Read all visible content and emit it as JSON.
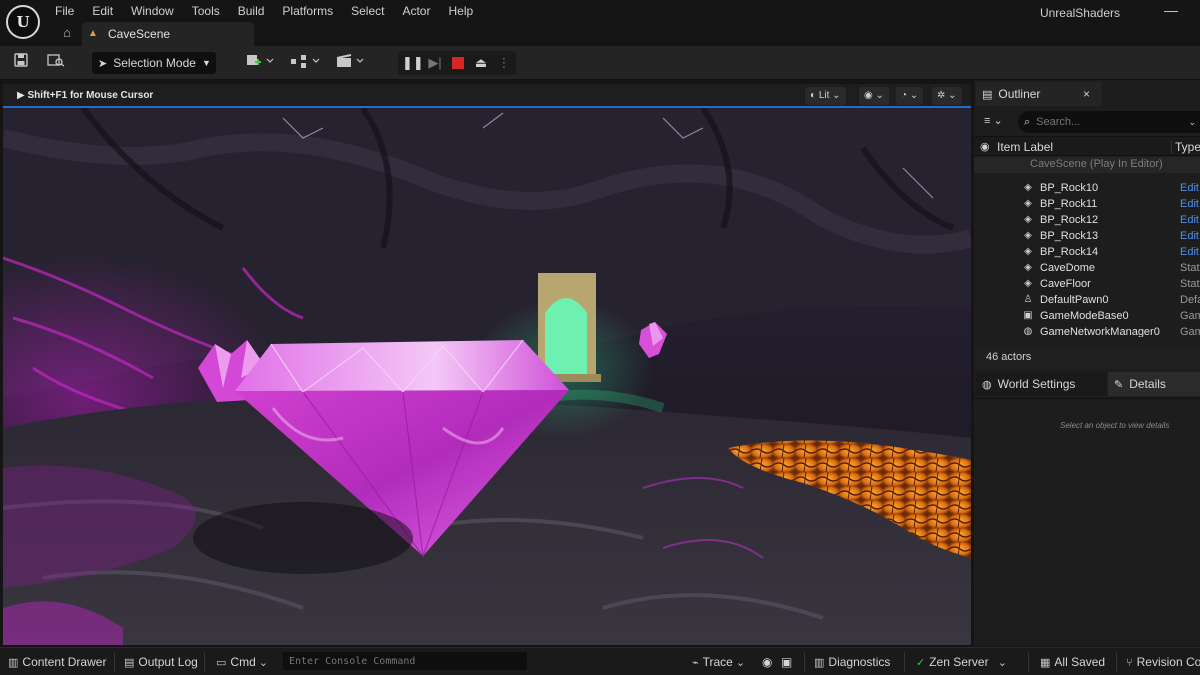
{
  "app": {
    "logo_text": "U",
    "project": "UnrealShaders",
    "minimize_glyph": "—"
  },
  "menu": [
    "File",
    "Edit",
    "Window",
    "Tools",
    "Build",
    "Platforms",
    "Select",
    "Actor",
    "Help"
  ],
  "doc_tab": {
    "label": "CaveScene"
  },
  "toolbar": {
    "selection_mode": "Selection Mode"
  },
  "viewport": {
    "hint": "Shift+F1 for Mouse Cursor",
    "view_mode": "Lit"
  },
  "outliner": {
    "tab": "Outliner",
    "search_placeholder": "Search...",
    "col_label": "Item Label",
    "col_type": "Type",
    "root": "CaveScene (Play In Editor)",
    "items": [
      {
        "name": "BP_Rock10",
        "type": "Edit",
        "icon": "blueprint-icon",
        "link": true
      },
      {
        "name": "BP_Rock11",
        "type": "Edit",
        "icon": "blueprint-icon",
        "link": true
      },
      {
        "name": "BP_Rock12",
        "type": "Edit",
        "icon": "blueprint-icon",
        "link": true
      },
      {
        "name": "BP_Rock13",
        "type": "Edit",
        "icon": "blueprint-icon",
        "link": true
      },
      {
        "name": "BP_Rock14",
        "type": "Edit",
        "icon": "blueprint-icon",
        "link": true
      },
      {
        "name": "CaveDome",
        "type": "Stat",
        "icon": "static-mesh-icon",
        "link": false
      },
      {
        "name": "CaveFloor",
        "type": "Stat",
        "icon": "static-mesh-icon",
        "link": false
      },
      {
        "name": "DefaultPawn0",
        "type": "Defa",
        "icon": "pawn-icon",
        "link": false
      },
      {
        "name": "GameModeBase0",
        "type": "Gam",
        "icon": "game-mode-icon",
        "link": false
      },
      {
        "name": "GameNetworkManager0",
        "type": "Gam",
        "icon": "network-manager-icon",
        "link": false
      }
    ],
    "actor_count": "46 actors"
  },
  "panels": {
    "world_settings": "World Settings",
    "details": "Details",
    "details_empty": "Select an object to view details"
  },
  "statusbar": {
    "content_drawer": "Content Drawer",
    "output_log": "Output Log",
    "cmd": "Cmd",
    "console_placeholder": "Enter Console Command",
    "trace": "Trace",
    "diagnostics": "Diagnostics",
    "zen_server": "Zen Server",
    "all_saved": "All Saved",
    "revision_control": "Revision Co"
  },
  "colors": {
    "accent": "#1f6fc8",
    "stop": "#d92525",
    "link": "#4f8fe8",
    "crystal": "#d838d8",
    "lava": "#f0a020",
    "portal": "#6ef0b0"
  }
}
